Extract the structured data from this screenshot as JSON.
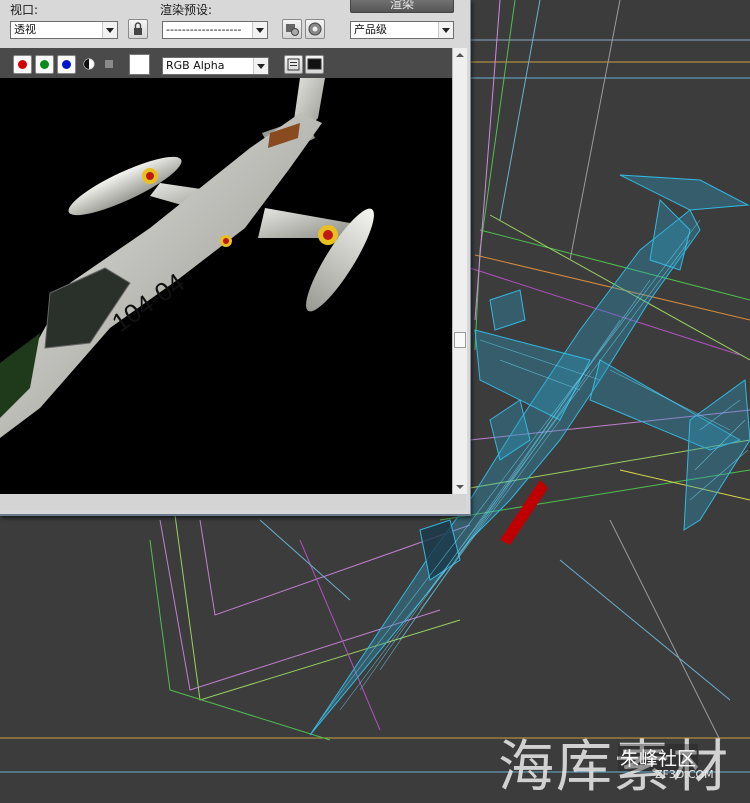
{
  "render_frame": {
    "viewport_label": "视口:",
    "viewport_value": "透视",
    "preset_label": "渲染预设:",
    "preset_value": "-------------------",
    "render_button_label": "渲染",
    "quality_value": "产品级",
    "channel_value": "RGB Alpha",
    "channels": [
      {
        "name": "red",
        "color": "#d40000"
      },
      {
        "name": "green",
        "color": "#0a8a1a"
      },
      {
        "name": "blue",
        "color": "#0018c8"
      }
    ],
    "aircraft_marking": "104-04"
  },
  "watermark": {
    "main_text": "海库素材",
    "site_name": "朱峰社区",
    "site_url": "ZF3D.COM"
  },
  "colors": {
    "viewport_bg": "#3c3c3c",
    "wireframe": "#33b8e0",
    "panel_bg": "#d8d8d8"
  }
}
